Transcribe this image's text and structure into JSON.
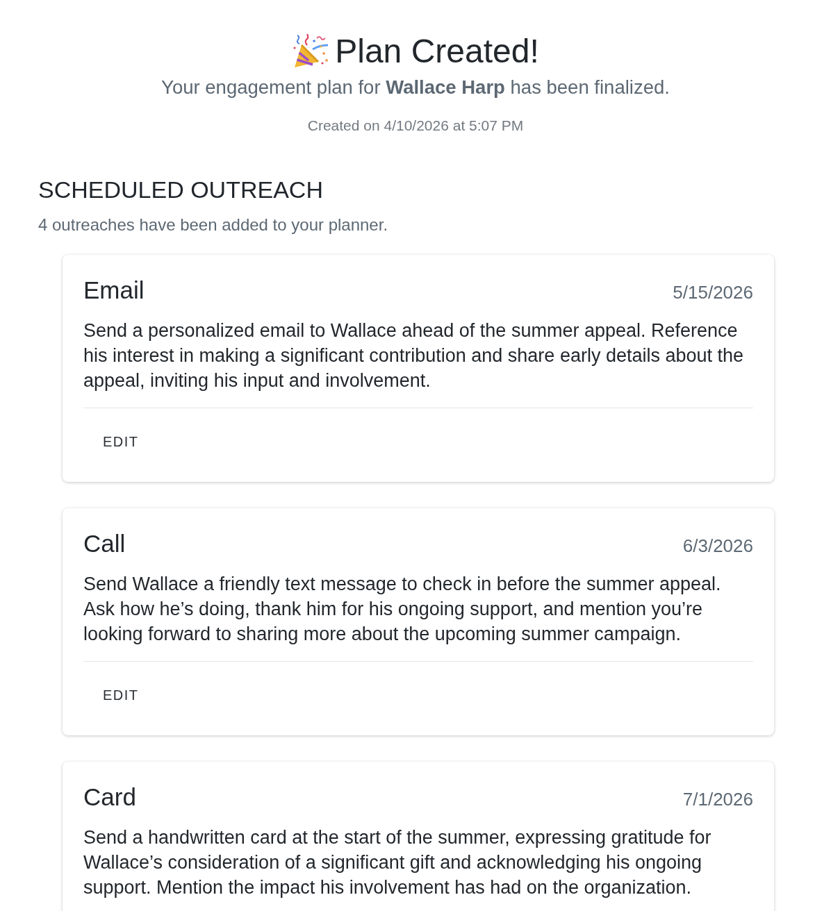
{
  "header": {
    "title": "Plan Created!",
    "subtitle": "Your engagement plan for **Wallace Harp** has been finalized.",
    "created": "Created on 4/10/2026 at 5:07 PM"
  },
  "section": {
    "heading": "SCHEDULED OUTREACH",
    "summary": "4 outreaches have been added to your planner."
  },
  "outreaches": [
    {
      "type": "Email",
      "date": "5/15/2026",
      "description": "Send a personalized email to Wallace ahead of the summer appeal. Reference his interest in making a significant contribution and share early details about the appeal, inviting his input and involvement.",
      "action": "EDIT"
    },
    {
      "type": "Call",
      "date": "6/3/2026",
      "description": "Send Wallace a friendly text message to check in before the summer appeal. Ask how he’s doing, thank him for his ongoing support, and mention you’re looking forward to sharing more about the upcoming summer campaign.",
      "action": "EDIT"
    },
    {
      "type": "Card",
      "date": "7/1/2026",
      "description": "Send a handwritten card at the start of the summer, expressing gratitude for Wallace’s consideration of a significant gift and acknowledging his ongoing support. Mention the impact his involvement has had on the organization."
    }
  ]
}
